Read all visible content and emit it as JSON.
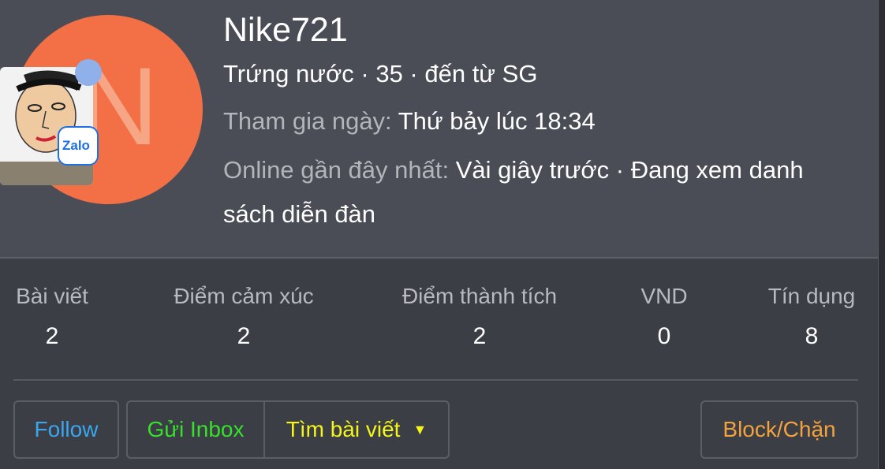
{
  "profile": {
    "username": "Nike721",
    "avatar_letter": "N",
    "avatar_color": "#f36f45",
    "rank_line": "Trứng nước · 35 · đến từ SG",
    "joined_label": "Tham gia ngày:",
    "joined_value": "Thứ bảy lúc 18:34",
    "online_label": "Online gần đây nhất:",
    "online_value": "Vài giây trước · Đang xem danh",
    "online_value_cont": "sách diễn đàn",
    "zalo_label": "Zalo"
  },
  "stats": [
    {
      "label": "Bài viết",
      "value": "2"
    },
    {
      "label": "Điểm cảm xúc",
      "value": "2"
    },
    {
      "label": "Điểm thành tích",
      "value": "2"
    },
    {
      "label": "VND",
      "value": "0"
    },
    {
      "label": "Tín dụng",
      "value": "8"
    }
  ],
  "actions": {
    "follow": "Follow",
    "inbox": "Gửi Inbox",
    "find_posts": "Tìm bài viết",
    "block": "Block/Chặn"
  },
  "colors": {
    "follow": "#3ba5ee",
    "inbox": "#37e02c",
    "find_posts": "#f5f51a",
    "block": "#f4a23e"
  }
}
